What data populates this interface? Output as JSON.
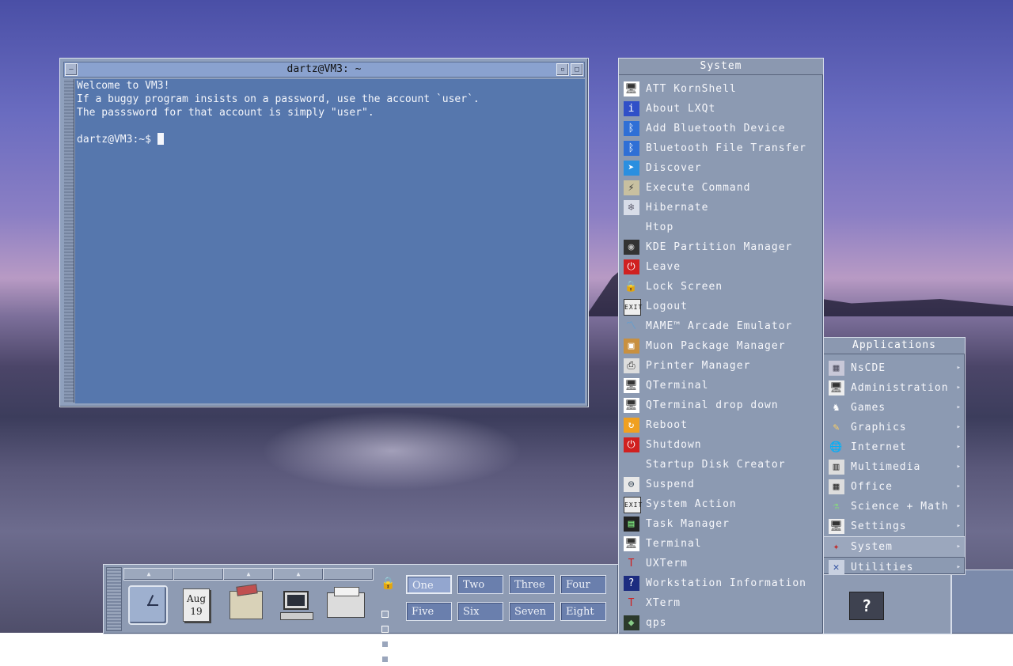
{
  "terminal": {
    "title": "dartz@VM3: ~",
    "lines": [
      "Welcome to VM3!",
      "If a buggy program insists on a password, use the account `user`.",
      "The passsword for that account is simply \"user\".",
      "",
      "dartz@VM3:~$ "
    ]
  },
  "system_menu": {
    "title": "System",
    "items": [
      {
        "label": "ATT KornShell",
        "icon": "terminal-icon"
      },
      {
        "label": "About LXQt",
        "icon": "info-icon"
      },
      {
        "label": "Add Bluetooth Device",
        "icon": "bluetooth-icon"
      },
      {
        "label": "Bluetooth File Transfer",
        "icon": "bluetooth-icon"
      },
      {
        "label": "Discover",
        "icon": "discover-icon"
      },
      {
        "label": "Execute Command",
        "icon": "lightning-icon"
      },
      {
        "label": "Hibernate",
        "icon": "hibernate-icon"
      },
      {
        "label": "Htop",
        "icon": ""
      },
      {
        "label": "KDE Partition Manager",
        "icon": "disk-icon"
      },
      {
        "label": "Leave",
        "icon": "power-icon"
      },
      {
        "label": "Lock Screen",
        "icon": "lock-icon"
      },
      {
        "label": "Logout",
        "icon": "exit-icon"
      },
      {
        "label": "MAME™ Arcade Emulator",
        "icon": "mame-icon"
      },
      {
        "label": "Muon Package Manager",
        "icon": "package-icon"
      },
      {
        "label": "Printer Manager",
        "icon": "printer-icon"
      },
      {
        "label": "QTerminal",
        "icon": "terminal-icon"
      },
      {
        "label": "QTerminal drop down",
        "icon": "terminal-icon"
      },
      {
        "label": "Reboot",
        "icon": "reboot-icon"
      },
      {
        "label": "Shutdown",
        "icon": "power-icon"
      },
      {
        "label": "Startup Disk Creator",
        "icon": ""
      },
      {
        "label": "Suspend",
        "icon": "suspend-icon"
      },
      {
        "label": "System Action",
        "icon": "exit-icon"
      },
      {
        "label": "Task Manager",
        "icon": "chart-icon"
      },
      {
        "label": "Terminal",
        "icon": "terminal-icon"
      },
      {
        "label": "UXTerm",
        "icon": "xterm-icon"
      },
      {
        "label": "Workstation Information",
        "icon": "help-icon"
      },
      {
        "label": "XTerm",
        "icon": "xterm-icon"
      },
      {
        "label": "qps",
        "icon": "qps-icon"
      }
    ]
  },
  "applications_menu": {
    "title": "Applications",
    "items": [
      {
        "label": "NsCDE",
        "icon": "nscde-icon"
      },
      {
        "label": "Administration",
        "icon": "monitor-icon"
      },
      {
        "label": "Games",
        "icon": "games-icon"
      },
      {
        "label": "Graphics",
        "icon": "graphics-icon"
      },
      {
        "label": "Internet",
        "icon": "globe-icon"
      },
      {
        "label": "Multimedia",
        "icon": "film-icon"
      },
      {
        "label": "Office",
        "icon": "office-icon"
      },
      {
        "label": "Science + Math",
        "icon": "science-icon"
      },
      {
        "label": "Settings",
        "icon": "monitor-icon"
      },
      {
        "label": "System",
        "icon": "system-icon"
      },
      {
        "label": "Utilities",
        "icon": "tools-icon"
      }
    ],
    "selected": "System"
  },
  "panel": {
    "calendar": {
      "month": "Aug",
      "day": "19"
    },
    "workspaces": [
      "One",
      "Two",
      "Three",
      "Four",
      "Five",
      "Six",
      "Seven",
      "Eight"
    ],
    "active_workspace": "One"
  },
  "colors": {
    "terminal_bg": "#5677ad",
    "menu_bg": "#8c9ab2",
    "frame": "#8fa0bd"
  }
}
